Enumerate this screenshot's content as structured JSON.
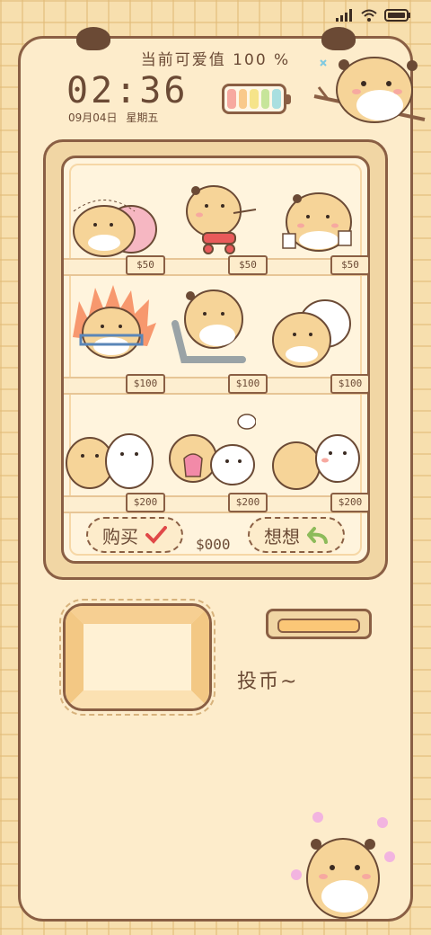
{
  "status": {
    "icons": [
      "signal-icon",
      "wifi-icon",
      "battery-status-icon"
    ]
  },
  "header": {
    "meter_text": "当前可爱值 100 %",
    "time": "02:36",
    "date": "09月04日 星期五"
  },
  "battery_widget": {
    "colors": [
      "#f7a9a0",
      "#f9c98b",
      "#f6e48a",
      "#c7e59a",
      "#a9dfe0"
    ]
  },
  "shelf": {
    "items": [
      {
        "name": "sleeping-hamster",
        "price": "$50"
      },
      {
        "name": "scooter-hamster",
        "price": "$50"
      },
      {
        "name": "sign-hamster",
        "price": "$50"
      },
      {
        "name": "angry-hamster",
        "price": "$100"
      },
      {
        "name": "chair-hamster",
        "price": "$100"
      },
      {
        "name": "hug-hamster",
        "price": "$100"
      },
      {
        "name": "couple-hamster",
        "price": "$200"
      },
      {
        "name": "gift-hamster",
        "price": "$200"
      },
      {
        "name": "shy-hamster",
        "price": "$200"
      }
    ]
  },
  "controls": {
    "buy_label": "购买",
    "think_label": "想想",
    "amount": "$000",
    "insert_coin": "投币~"
  },
  "colors": {
    "accent": "#8a5f44",
    "background": "#f7dfae",
    "panel": "#fdeccb"
  }
}
